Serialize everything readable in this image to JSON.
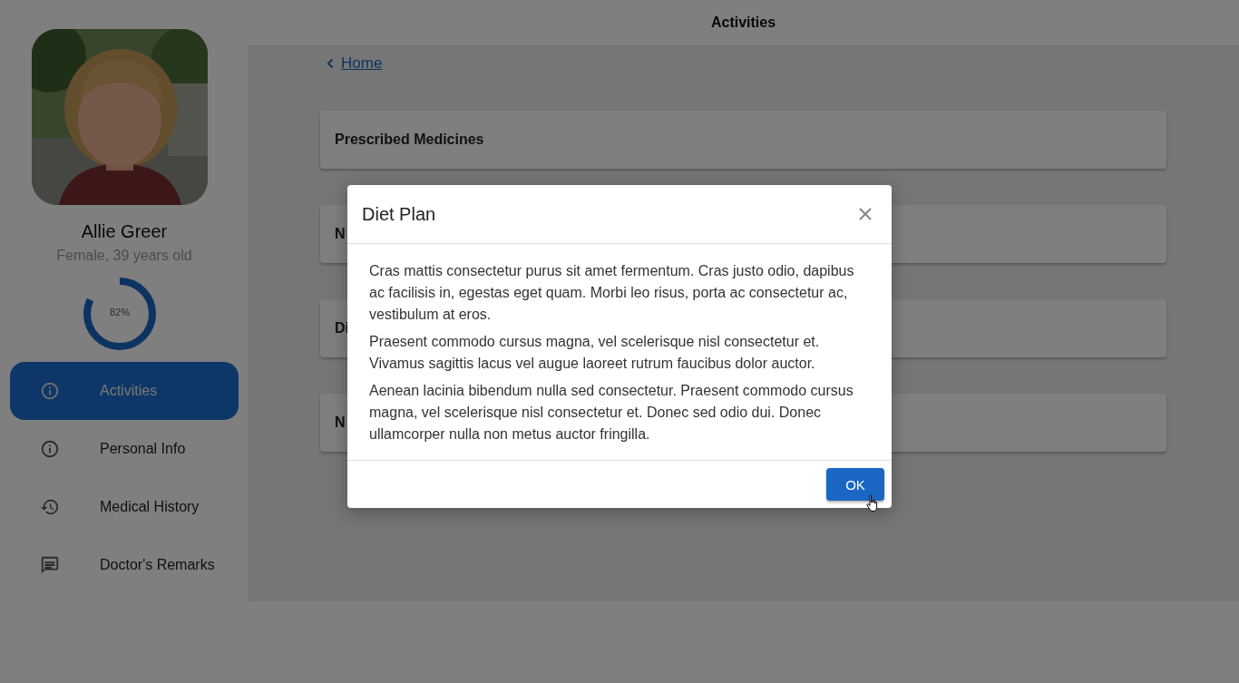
{
  "header": {
    "title": "Activities"
  },
  "profile": {
    "name": "Allie Greer",
    "details": "Female, 39 years old",
    "progress": {
      "level": 0.82,
      "reading": "82%"
    }
  },
  "nav": [
    {
      "label": "Activities",
      "kind": "info",
      "selected": true
    },
    {
      "label": "Personal Info",
      "kind": "info",
      "selected": false
    },
    {
      "label": "Medical History",
      "kind": "history",
      "selected": false
    },
    {
      "label": "Doctor's Remarks",
      "kind": "comment",
      "selected": false
    }
  ],
  "breadcrumb": {
    "label": "Home"
  },
  "cards": [
    {
      "title": "Prescribed Medicines"
    },
    {
      "title": "N"
    },
    {
      "title": "Di"
    },
    {
      "title": "N"
    }
  ],
  "modal": {
    "title": "Diet Plan",
    "paragraphs": [
      "Cras mattis consectetur purus sit amet fermentum. Cras justo odio, dapibus ac facilisis in, egestas eget quam. Morbi leo risus, porta ac consectetur ac, vestibulum at eros.",
      "Praesent commodo cursus magna, vel scelerisque nisl consectetur et. Vivamus sagittis lacus vel augue laoreet rutrum faucibus dolor auctor.",
      "Aenean lacinia bibendum nulla sed consectetur. Praesent commodo cursus magna, vel scelerisque nisl consectetur et. Donec sed odio dui. Donec ullamcorper nulla non metus auctor fringilla."
    ],
    "button": "OK"
  }
}
